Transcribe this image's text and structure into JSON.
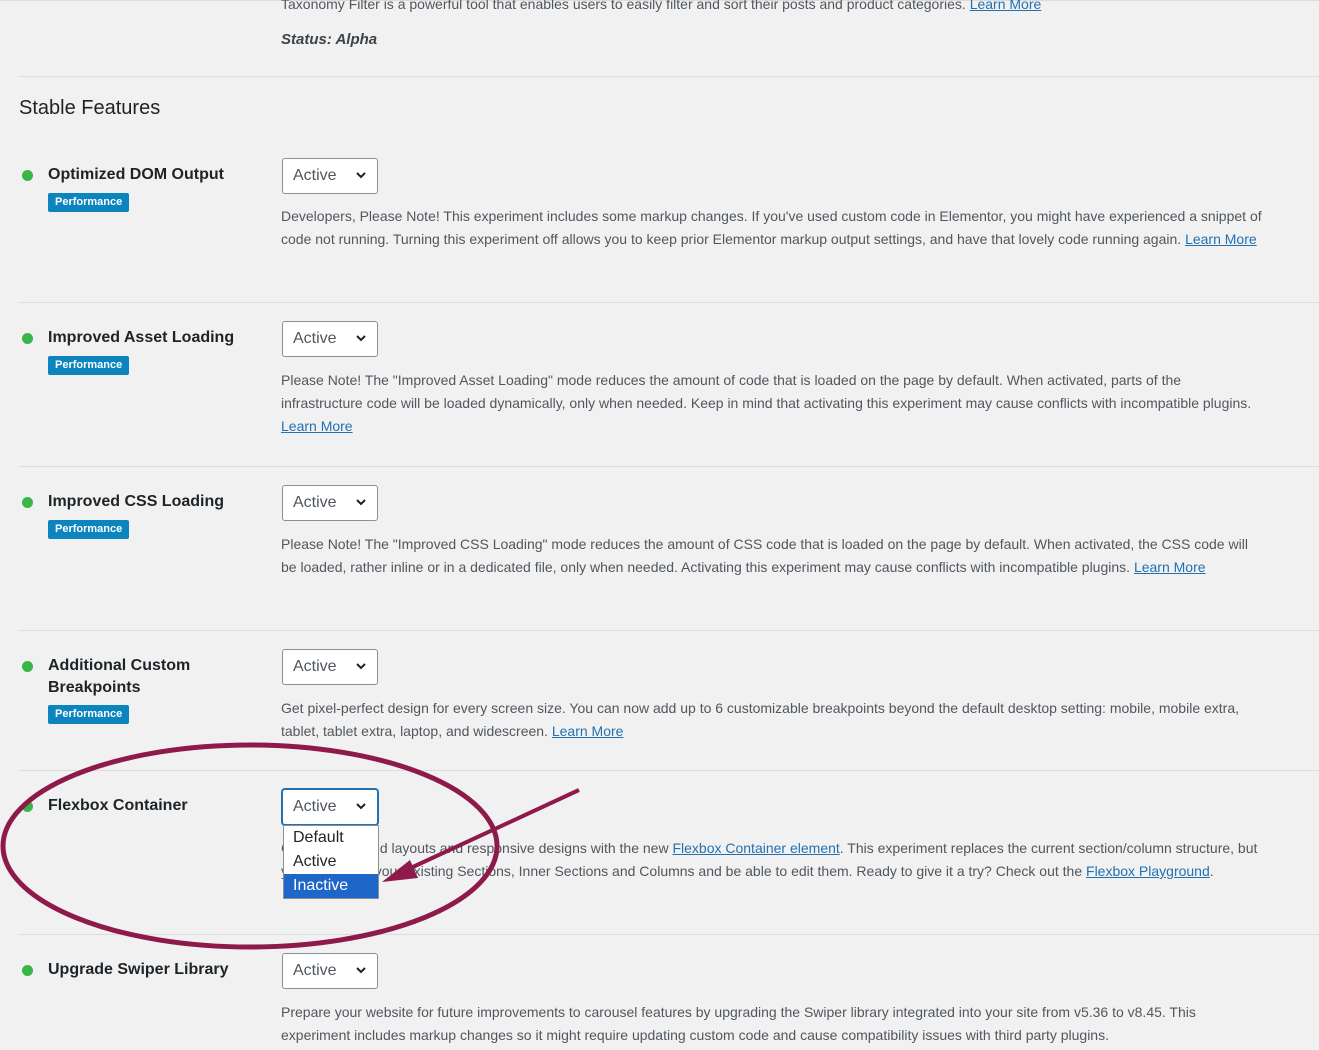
{
  "intro": {
    "description": "Taxonomy Filter is a powerful tool that enables users to easily filter and sort their posts and product categories.",
    "learn_more": "Learn More",
    "status": "Status: Alpha"
  },
  "section": {
    "title": "Stable Features"
  },
  "features": [
    {
      "name": "Optimized DOM Output",
      "tag": "Performance",
      "select_value": "Active",
      "description": "Developers, Please Note! This experiment includes some markup changes. If you've used custom code in Elementor, you might have experienced a snippet of code not running. Turning this experiment off allows you to keep prior Elementor markup output settings, and have that lovely code running again.",
      "link": "Learn More"
    },
    {
      "name": "Improved Asset Loading",
      "tag": "Performance",
      "select_value": "Active",
      "description": "Please Note! The \"Improved Asset Loading\" mode reduces the amount of code that is loaded on the page by default. When activated, parts of the infrastructure code will be loaded dynamically, only when needed. Keep in mind that activating this experiment may cause conflicts with incompatible plugins.",
      "link": "Learn More"
    },
    {
      "name": "Improved CSS Loading",
      "tag": "Performance",
      "select_value": "Active",
      "description": "Please Note! The \"Improved CSS Loading\" mode reduces the amount of CSS code that is loaded on the page by default. When activated, the CSS code will be loaded, rather inline or in a dedicated file, only when needed. Activating this experiment may cause conflicts with incompatible plugins.",
      "link": "Learn More"
    },
    {
      "name": "Additional Custom Breakpoints",
      "tag": "Performance",
      "select_value": "Active",
      "description": "Get pixel-perfect design for every screen size. You can now add up to 6 customizable breakpoints beyond the default desktop setting: mobile, mobile extra, tablet, tablet extra, laptop, and widescreen.",
      "link": "Learn More"
    },
    {
      "name": "Flexbox Container",
      "select_value": "Active",
      "description_pre": "Create advanced layouts and responsive designs with the new",
      "description_link": "Flexbox Container element",
      "description_post": ". This experiment replaces the current section/column structure, but you'll still keep your existing Sections, Inner Sections and Columns and be able to edit them. Ready to give it a try? Check out the",
      "link": "Flexbox Playground",
      "dropdown_options": [
        "Default",
        "Active",
        "Inactive"
      ],
      "dropdown_highlighted": "Inactive"
    },
    {
      "name": "Upgrade Swiper Library",
      "select_value": "Active",
      "description": "Prepare your website for future improvements to carousel features by upgrading the Swiper library integrated into your site from v5.36 to v8.45. This experiment includes markup changes so it might require updating custom code and cause compatibility issues with third party plugins."
    }
  ],
  "colors": {
    "status_active": "#39b54a",
    "badge": "#0c84be",
    "link": "#2271b1",
    "annotation": "#8e1a4c",
    "dropdown_highlight": "#1e66c8"
  }
}
